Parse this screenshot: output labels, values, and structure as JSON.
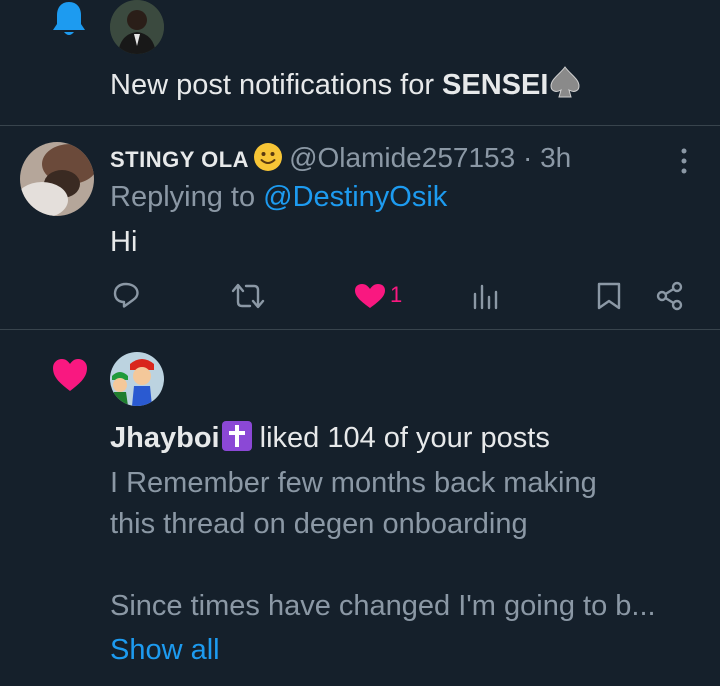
{
  "colors": {
    "background": "#15202b",
    "divider": "#38444d",
    "text_primary": "#e7e9ea",
    "text_secondary": "#8b98a5",
    "accent_blue": "#1d9bf0",
    "like_pink": "#f91880"
  },
  "notification_1": {
    "icon": "bell-icon",
    "prefix": "New post notifications for ",
    "user_name": "SENSEI",
    "emoji": "spade-icon"
  },
  "reply": {
    "author_name": "STINGY OLA",
    "author_emoji": "smiley-icon",
    "handle": "@Olamide257153",
    "separator": "·",
    "time": "3h",
    "replying_prefix": "Replying to ",
    "replying_handle": "@DestinyOsik",
    "body": "Hi",
    "actions": {
      "reply_icon": "reply-icon",
      "repost_icon": "repost-icon",
      "like_icon": "heart-icon",
      "like_count": "1",
      "views_icon": "views-icon",
      "bookmark_icon": "bookmark-icon",
      "share_icon": "share-icon"
    }
  },
  "notification_2": {
    "icon": "heart-icon",
    "user_name": "Jhayboi",
    "user_emoji": "latin-cross-icon",
    "action_text": " liked 104 of your posts",
    "preview_lines": [
      "I Remember few months back making",
      "this thread on degen onboarding",
      "",
      "Since times have changed I'm going to b..."
    ],
    "show_all": "Show all"
  }
}
